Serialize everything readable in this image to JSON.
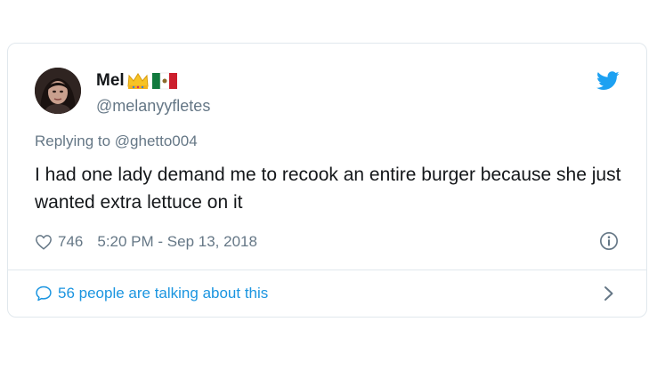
{
  "tweet": {
    "display_name": "Mel",
    "name_emoji": [
      "crown-emoji",
      "mexico-flag-emoji"
    ],
    "handle": "@melanyyfletes",
    "replying_to": "Replying to @ghetto004",
    "text": "I had one lady demand me to recook an entire burger because she just wanted extra lettuce on it",
    "likes": "746",
    "timestamp": "5:20 PM - Sep 13, 2018",
    "conversation": "56 people are talking about this"
  },
  "icons": {
    "brand": "twitter-bird-icon",
    "like": "heart-icon",
    "info": "info-icon",
    "conversation": "speech-bubble-icon",
    "open": "chevron-right-icon"
  },
  "colors": {
    "twitter_blue": "#1da1f2",
    "link_blue": "#1b95e0",
    "text": "#14171a",
    "muted": "#657786",
    "border": "#e1e8ed"
  }
}
